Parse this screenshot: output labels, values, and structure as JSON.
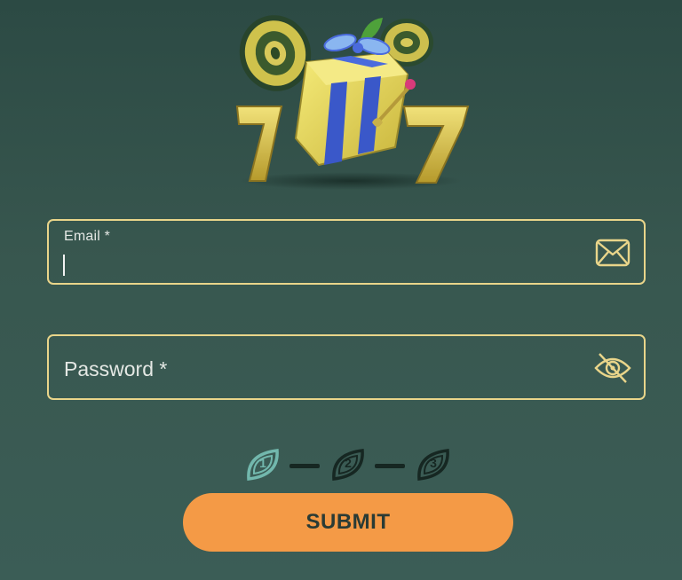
{
  "form": {
    "email": {
      "label": "Email",
      "required_mark": "*",
      "value": "",
      "icon": "envelope-icon"
    },
    "password": {
      "placeholder": "Password",
      "required_mark": "*",
      "icon": "eye-slash-icon"
    },
    "submit_label": "SUBMIT"
  },
  "steps": [
    {
      "number": "1",
      "state": "active"
    },
    {
      "number": "2",
      "state": "inactive"
    },
    {
      "number": "3",
      "state": "inactive"
    }
  ],
  "colors": {
    "background": "#2c4a44",
    "field_border": "#e9d58a",
    "accent_button": "#f49a46",
    "step_active": "#72b8ad",
    "step_inactive": "#162722"
  }
}
